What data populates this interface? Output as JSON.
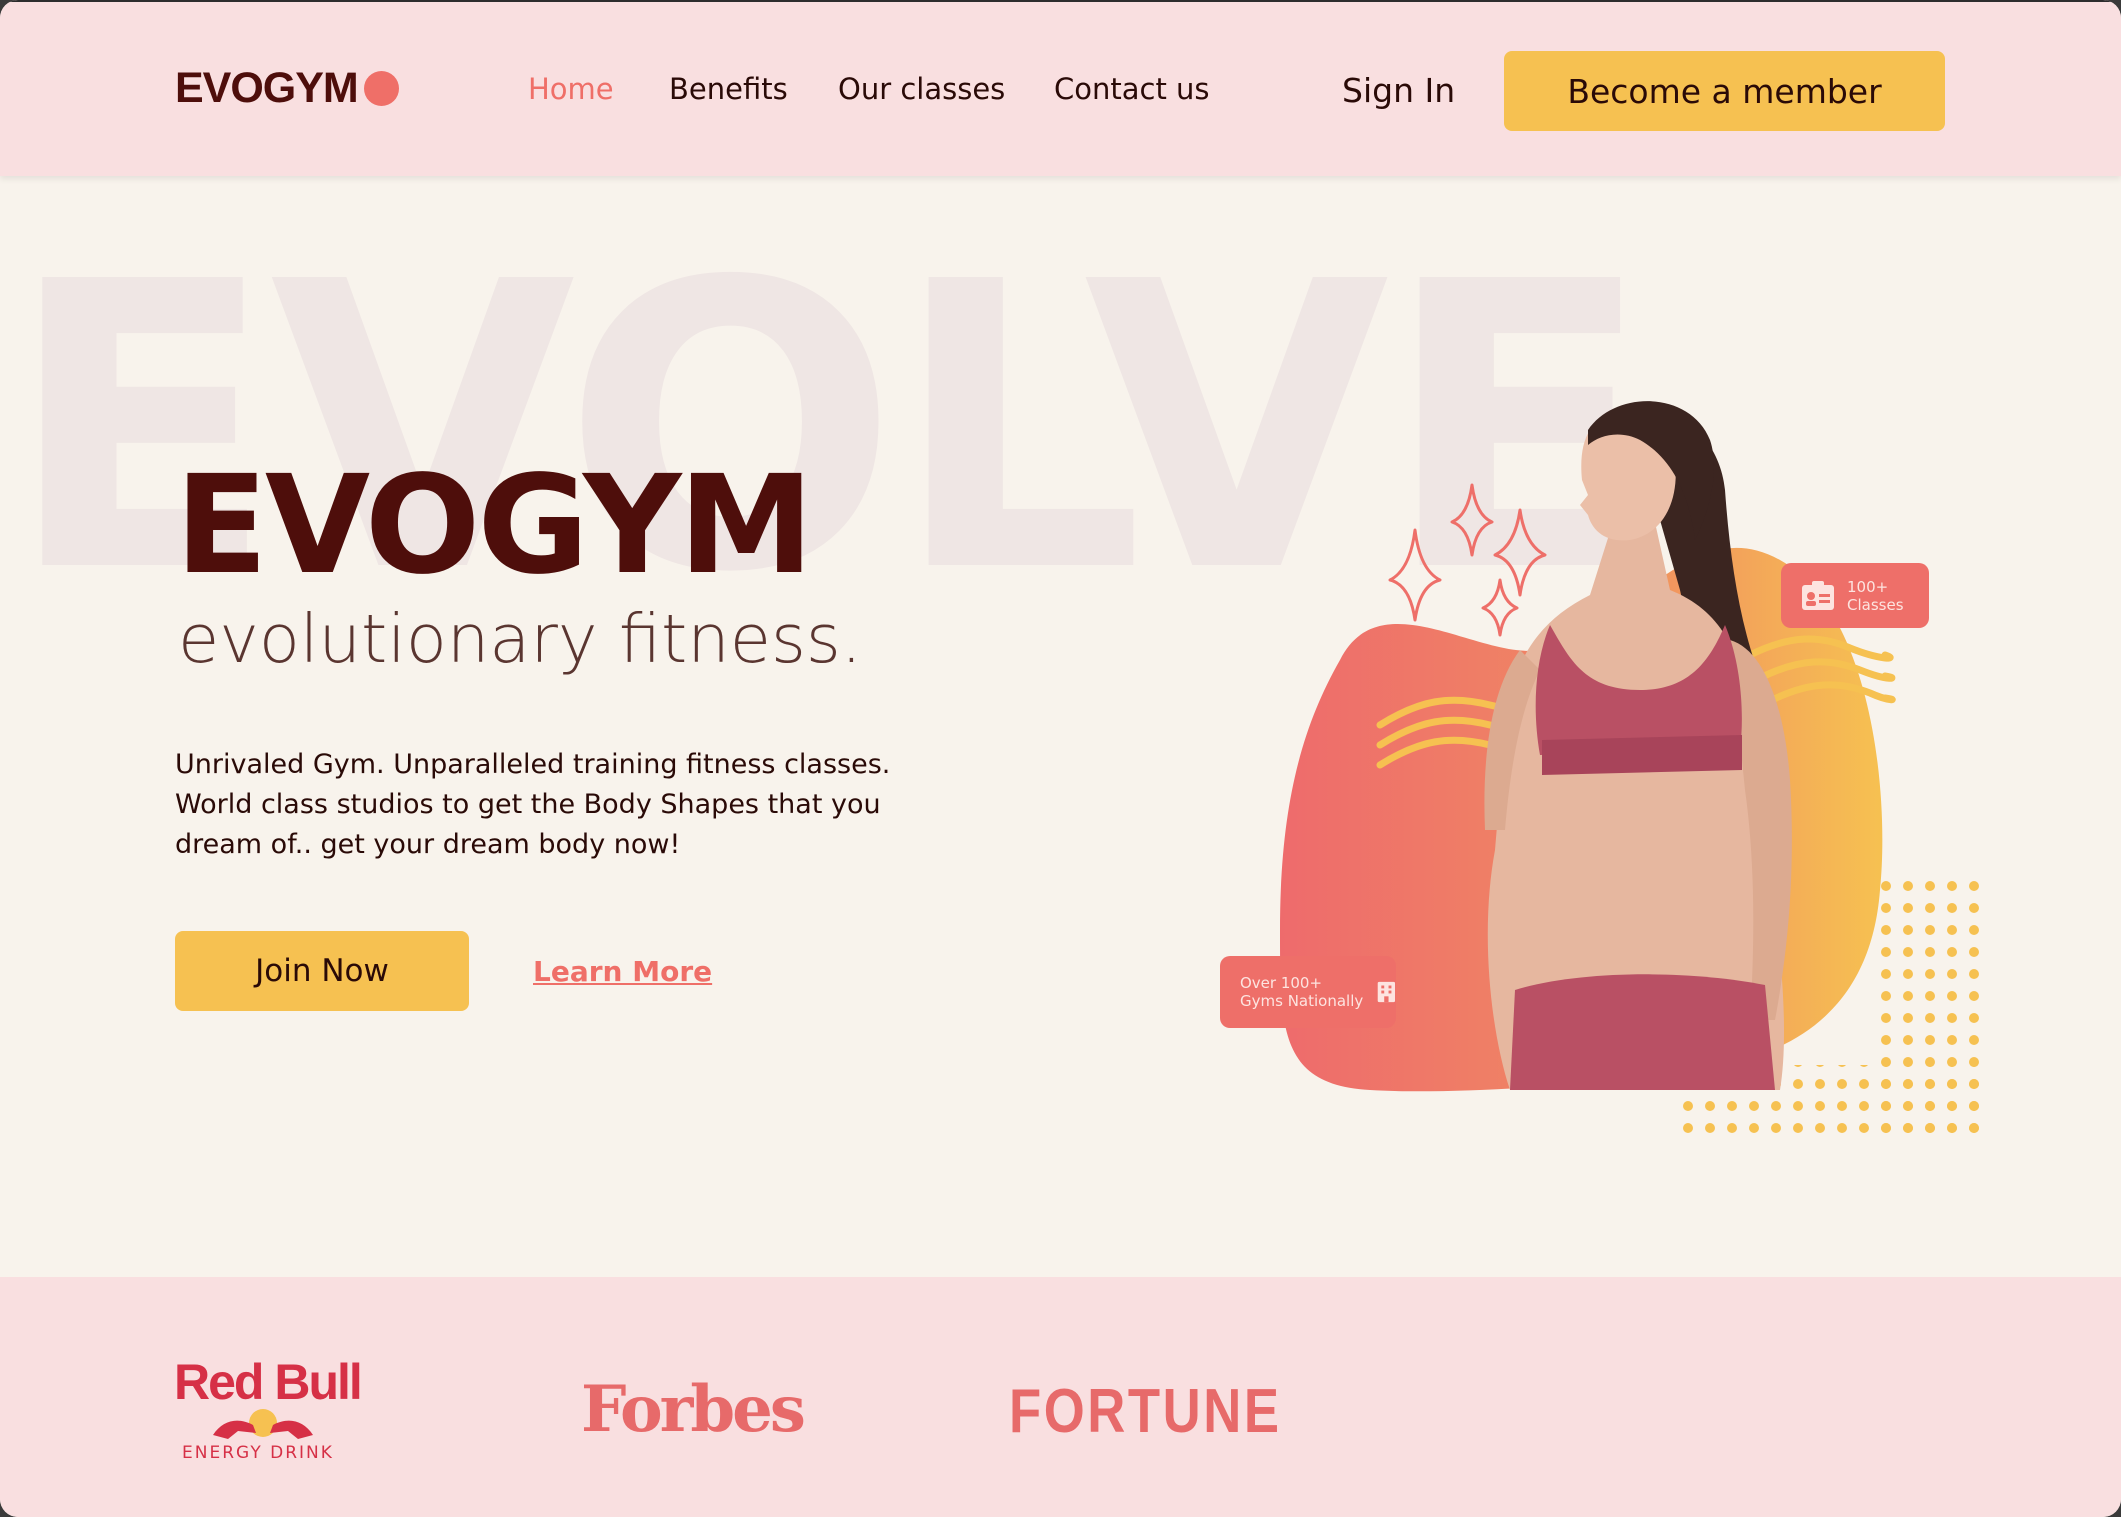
{
  "brand": {
    "name": "EVOGYM",
    "accent": "#ef6f68",
    "dark": "#4e0e0b",
    "yellow": "#f6c151"
  },
  "nav": {
    "links": [
      "Home",
      "Benefits",
      "Our classes",
      "Contact us"
    ],
    "active": "Home",
    "sign_in": "Sign In",
    "cta": "Become a member"
  },
  "hero": {
    "background_word": "EVOLVE",
    "title": "EVOGYM",
    "subtitle": "evolutionary fitness.",
    "description": "Unrivaled Gym. Unparalleled training fitness classes. World class studios to get the Body Shapes that you dream of.. get your dream body now!",
    "join_label": "Join Now",
    "learn_label": "Learn More",
    "badge_classes": {
      "line1": "100+",
      "line2": "Classes",
      "icon": "id-card-icon"
    },
    "badge_gyms": {
      "line1": "Over 100+",
      "line2": "Gyms Nationally",
      "icon": "building-icon"
    }
  },
  "sponsors": {
    "redbull": {
      "name": "Red Bull",
      "sub": "ENERGY DRINK"
    },
    "forbes": "Forbes",
    "fortune": "FORTUNE"
  }
}
